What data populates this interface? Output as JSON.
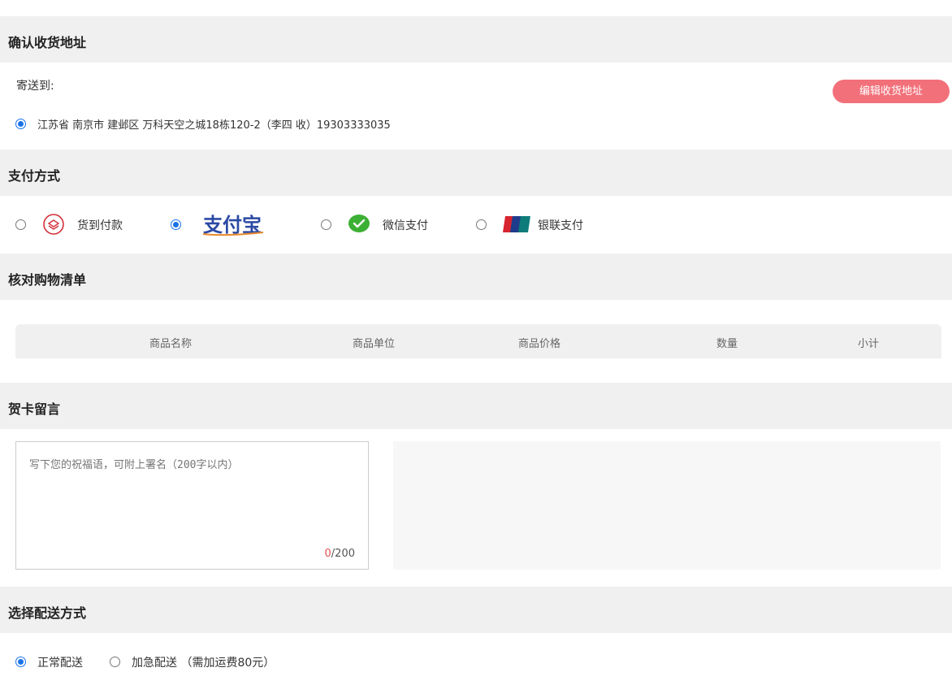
{
  "address": {
    "section_title": "确认收货地址",
    "ship_to_label": "寄送到:",
    "edit_button": "编辑收货地址",
    "selected_address": "江苏省 南京市 建邺区 万科天空之城18栋120-2（李四 收）19303333035"
  },
  "payment": {
    "section_title": "支付方式",
    "options": [
      {
        "label": "货到付款",
        "icon": "cod-icon",
        "selected": false
      },
      {
        "label": "支付宝",
        "icon": "alipay-logo",
        "selected": true
      },
      {
        "label": "微信支付",
        "icon": "wechat-icon",
        "selected": false
      },
      {
        "label": "银联支付",
        "icon": "unionpay-icon",
        "selected": false
      }
    ]
  },
  "cart": {
    "section_title": "核对购物清单",
    "columns": [
      "商品名称",
      "商品单位",
      "商品价格",
      "数量",
      "小计"
    ]
  },
  "card_message": {
    "section_title": "贺卡留言",
    "placeholder": "写下您的祝福语，可附上署名（200字以内）",
    "count_current": "0",
    "count_max": "/200"
  },
  "delivery": {
    "section_title": "选择配送方式",
    "options": [
      {
        "label": "正常配送",
        "selected": true
      },
      {
        "label": "加急配送 （需加运费80元）",
        "selected": false
      }
    ]
  },
  "colors": {
    "accent_blue": "#1a73e8",
    "edit_button_bg": "#f2707a",
    "section_bg": "#f0f0f0",
    "counter_red": "#e05050"
  }
}
